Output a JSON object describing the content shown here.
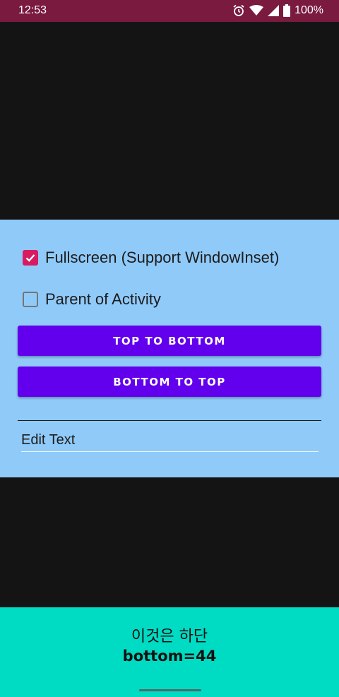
{
  "status_bar": {
    "time": "12:53",
    "battery": "100%",
    "icons": [
      "alarm-icon",
      "wifi-icon",
      "signal-icon",
      "battery-icon"
    ],
    "color": "#791a3e"
  },
  "panel": {
    "background": "#90caf9",
    "checkboxes": [
      {
        "label": "Fullscreen (Support WindowInset)",
        "checked": true
      },
      {
        "label": "Parent of Activity",
        "checked": false
      }
    ],
    "buttons": {
      "top_to_bottom": "TOP TO BOTTOM",
      "bottom_to_top": "BOTTOM TO TOP"
    },
    "button_color": "#6200ee",
    "edit_text": "Edit Text"
  },
  "bottom_bar": {
    "title": "이것은 하단",
    "subtitle": "bottom=44",
    "background": "#00dbc4"
  }
}
